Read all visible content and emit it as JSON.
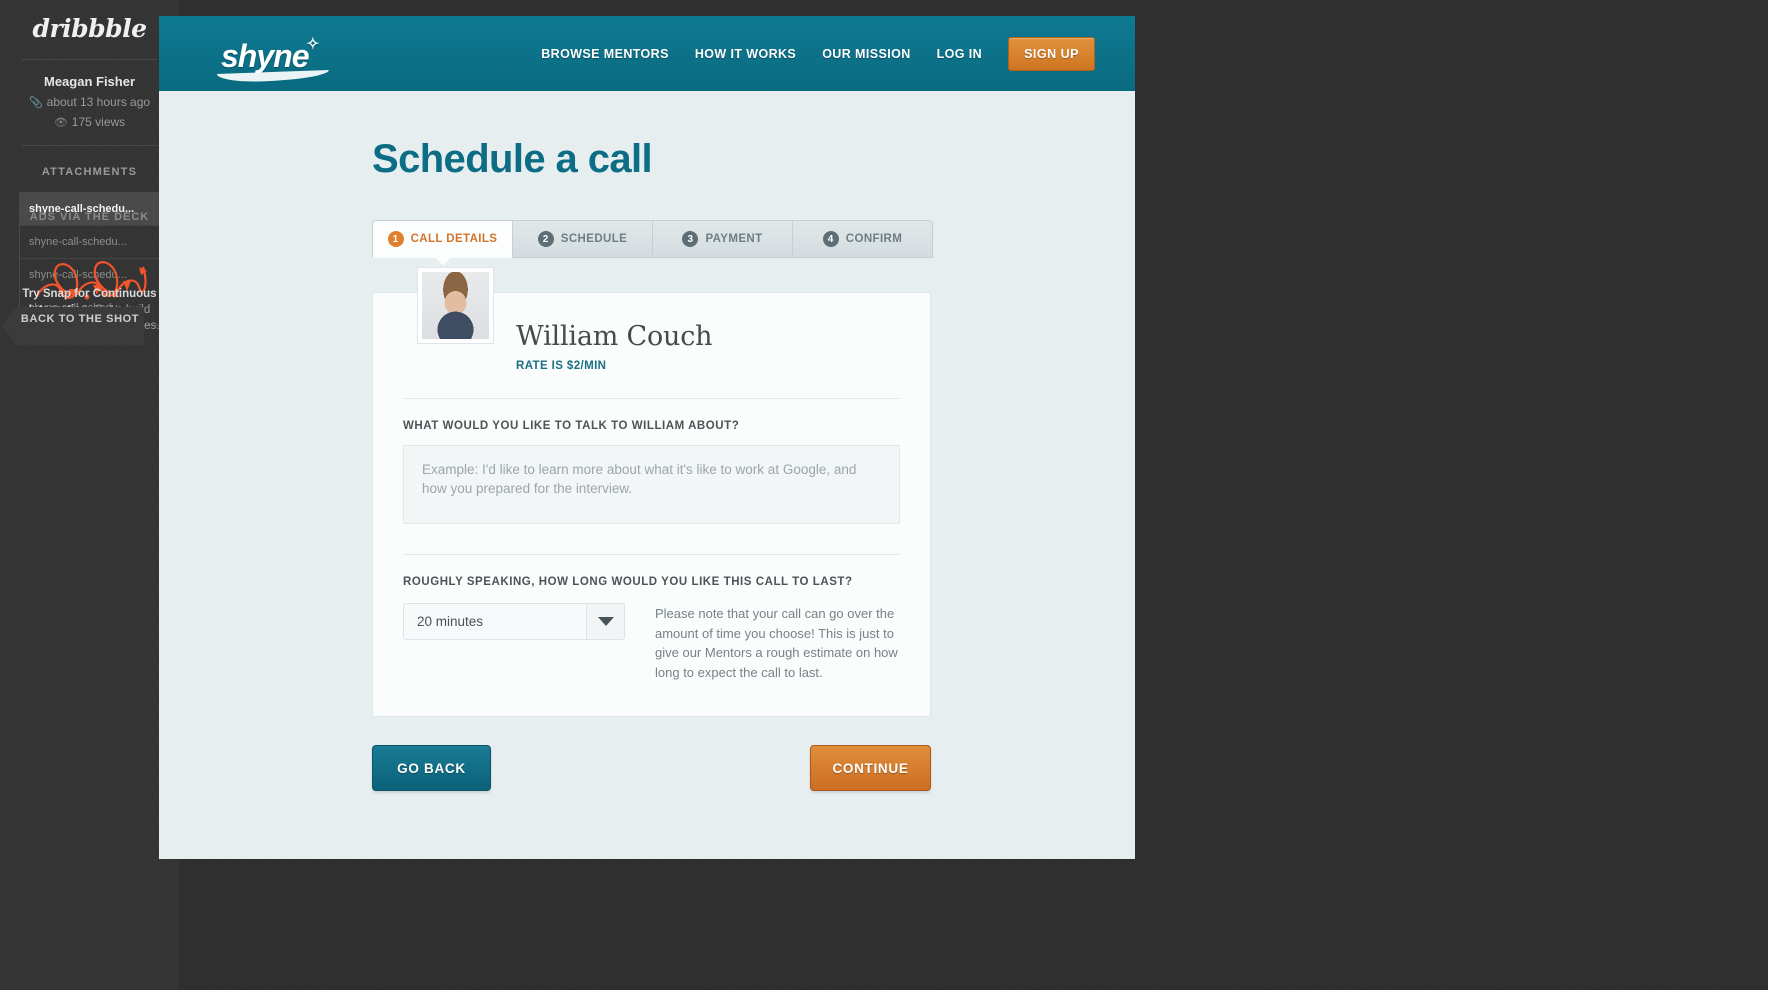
{
  "dribbble": {
    "logo_text": "dribbble",
    "author": "Meagan Fisher",
    "time_ago": "about 13 hours ago",
    "views": "175 views",
    "attach_icon": "paperclip-icon",
    "views_icon": "eye-icon",
    "section_title": "ATTACHMENTS",
    "attachments": [
      "shyne-call-schedu...",
      "shyne-call-schedu...",
      "shyne-call-schedu...",
      "shyne-call-schedu..."
    ],
    "ads_title": "ADS VIA THE DECK",
    "ads_bold": "Try Snap for Continuous Integration",
    "ads_rest": ". Get a build pipeline running in minutes.",
    "back_tab": "BACK TO THE SHOT"
  },
  "site": {
    "logo": "shyne",
    "nav": [
      {
        "label": "BROWSE MENTORS"
      },
      {
        "label": "HOW IT WORKS"
      },
      {
        "label": "OUR MISSION"
      },
      {
        "label": "LOG IN"
      }
    ],
    "signup_label": "SIGN UP",
    "brand_teal": "#0c7289",
    "brand_orange": "#d9822b"
  },
  "main": {
    "title": "Schedule a call",
    "steps": [
      {
        "num": "1",
        "label": "CALL DETAILS",
        "active": true
      },
      {
        "num": "2",
        "label": "SCHEDULE",
        "active": false
      },
      {
        "num": "3",
        "label": "PAYMENT",
        "active": false
      },
      {
        "num": "4",
        "label": "CONFIRM",
        "active": false
      }
    ],
    "mentor": {
      "name": "William Couch",
      "rate": "RATE IS $2/MIN",
      "avatar_name": "mentor-avatar"
    },
    "topic": {
      "label": "WHAT WOULD YOU LIKE TO TALK TO WILLIAM ABOUT?",
      "value": "",
      "placeholder": "Example: I'd like to learn more about what it's like to work at Google, and how you prepared for the interview."
    },
    "duration": {
      "label": "ROUGHLY SPEAKING, HOW LONG WOULD YOU LIKE THIS CALL TO LAST?",
      "selected": "20 minutes",
      "note": "Please note that your call can go over the amount of time you choose! This is just to give our Mentors a rough estimate on how long to expect the call to last."
    },
    "buttons": {
      "back": "GO BACK",
      "continue": "CONTINUE"
    }
  }
}
